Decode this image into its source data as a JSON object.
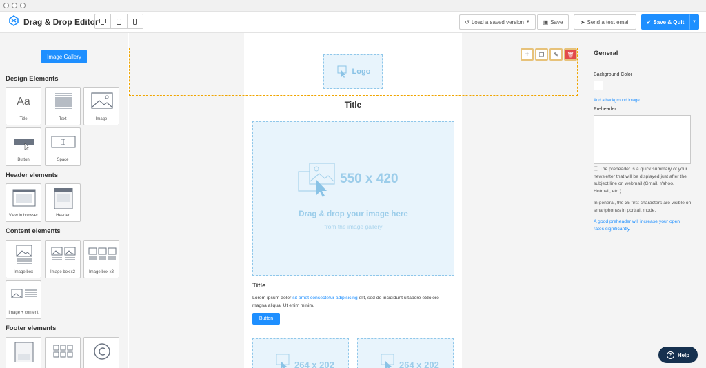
{
  "app": {
    "title": "Drag & Drop Editor"
  },
  "toolbar": {
    "devices": [
      "desktop-icon",
      "tablet-icon",
      "mobile-icon"
    ],
    "load_label": "Load a saved version",
    "save_label": "Save",
    "test_email_label": "Send a test email",
    "save_quit_label": "Save & Quit"
  },
  "left": {
    "gallery_button": "Image Gallery",
    "design": {
      "title": "Design Elements",
      "items": [
        "Title",
        "Text",
        "Image",
        "Button",
        "Space"
      ]
    },
    "header": {
      "title": "Header elements",
      "items": [
        "View in browser",
        "Header"
      ]
    },
    "content": {
      "title": "Content elements",
      "items": [
        "Image box",
        "Image box x2",
        "Image box x3",
        "Image + content"
      ]
    },
    "footer": {
      "title": "Footer elements"
    },
    "title_tile_glyph": "Aa"
  },
  "canvas": {
    "logo_label": "Logo",
    "title": "Title",
    "image_dims": "550 x 420",
    "drag_text": "Drag & drop your image here",
    "gallery_text": "from the image gallery",
    "sub_title": "Title",
    "lorem_before": "Lorem ipsum dolor ",
    "lorem_link": "sit amet consectetur adipisicing",
    "lorem_after": " elit, sed do incididunt ultabore etdolore magna aliqua. Ut enim minim.",
    "button_label": "Button",
    "small_dims": "264 x 202"
  },
  "right": {
    "title": "General",
    "bg_color_label": "Background Color",
    "bg_image_link": "Add a background image",
    "preheader_label": "Preheader",
    "info_1": "The preheader is a quick summary of your newsletter that will be displayed just after the subject line on webmail (Gmail, Yahoo, Hotmail, etc.).",
    "info_2": "In general, the 35 first characters are visible on smartphones in portrait mode.",
    "info_3": "A good preheader will increase your open rates significantly."
  },
  "help": {
    "label": "Help"
  },
  "colors": {
    "accent": "#1e8fff",
    "selection": "#f0a500",
    "danger": "#e24b4b",
    "help_bg": "#16314f"
  }
}
